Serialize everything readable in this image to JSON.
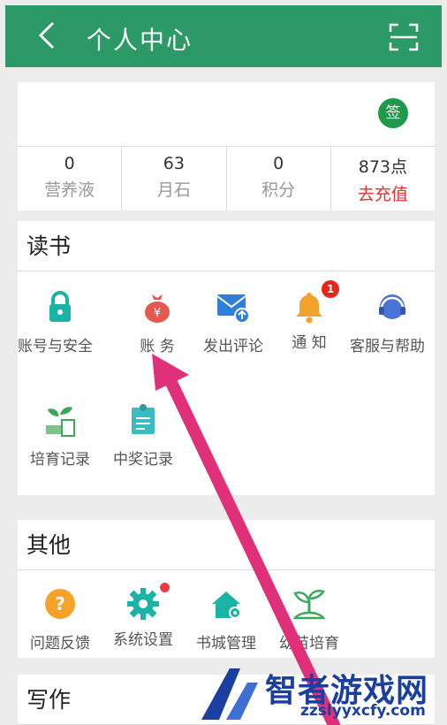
{
  "header": {
    "title": "个人中心",
    "back_icon": "back-arrow-icon",
    "scan_icon": "scan-icon"
  },
  "user": {
    "sign_label": "签",
    "stats": [
      {
        "value": "0",
        "label": "营养液"
      },
      {
        "value": "63",
        "label": "月石"
      },
      {
        "value": "0",
        "label": "积分"
      },
      {
        "value": "873点",
        "label": "去充值"
      }
    ]
  },
  "reading": {
    "title": "读书",
    "items": [
      {
        "label": "账号与安全",
        "icon": "lock-icon"
      },
      {
        "label": "账 务",
        "icon": "money-bag-icon"
      },
      {
        "label": "发出评论",
        "icon": "mail-upload-icon"
      },
      {
        "label": "通 知",
        "icon": "bell-icon",
        "badge": "1"
      },
      {
        "label": "客服与帮助",
        "icon": "headset-icon"
      },
      {
        "label": "培育记录",
        "icon": "sprout-record-icon"
      },
      {
        "label": "中奖记录",
        "icon": "prize-record-icon"
      }
    ]
  },
  "other": {
    "title": "其他",
    "items": [
      {
        "label": "问题反馈",
        "icon": "question-icon"
      },
      {
        "label": "系统设置",
        "icon": "gear-icon"
      },
      {
        "label": "书城管理",
        "icon": "house-gear-icon"
      },
      {
        "label": "幼苗培育",
        "icon": "sprout-icon"
      }
    ]
  },
  "writing": {
    "title": "写作"
  },
  "watermark": {
    "big": "智者游戏网",
    "small": "zzslyyxcfy.com"
  },
  "colors": {
    "brand": "#2b9a66",
    "accent_red": "#e03232",
    "arrow": "#e0307a"
  }
}
